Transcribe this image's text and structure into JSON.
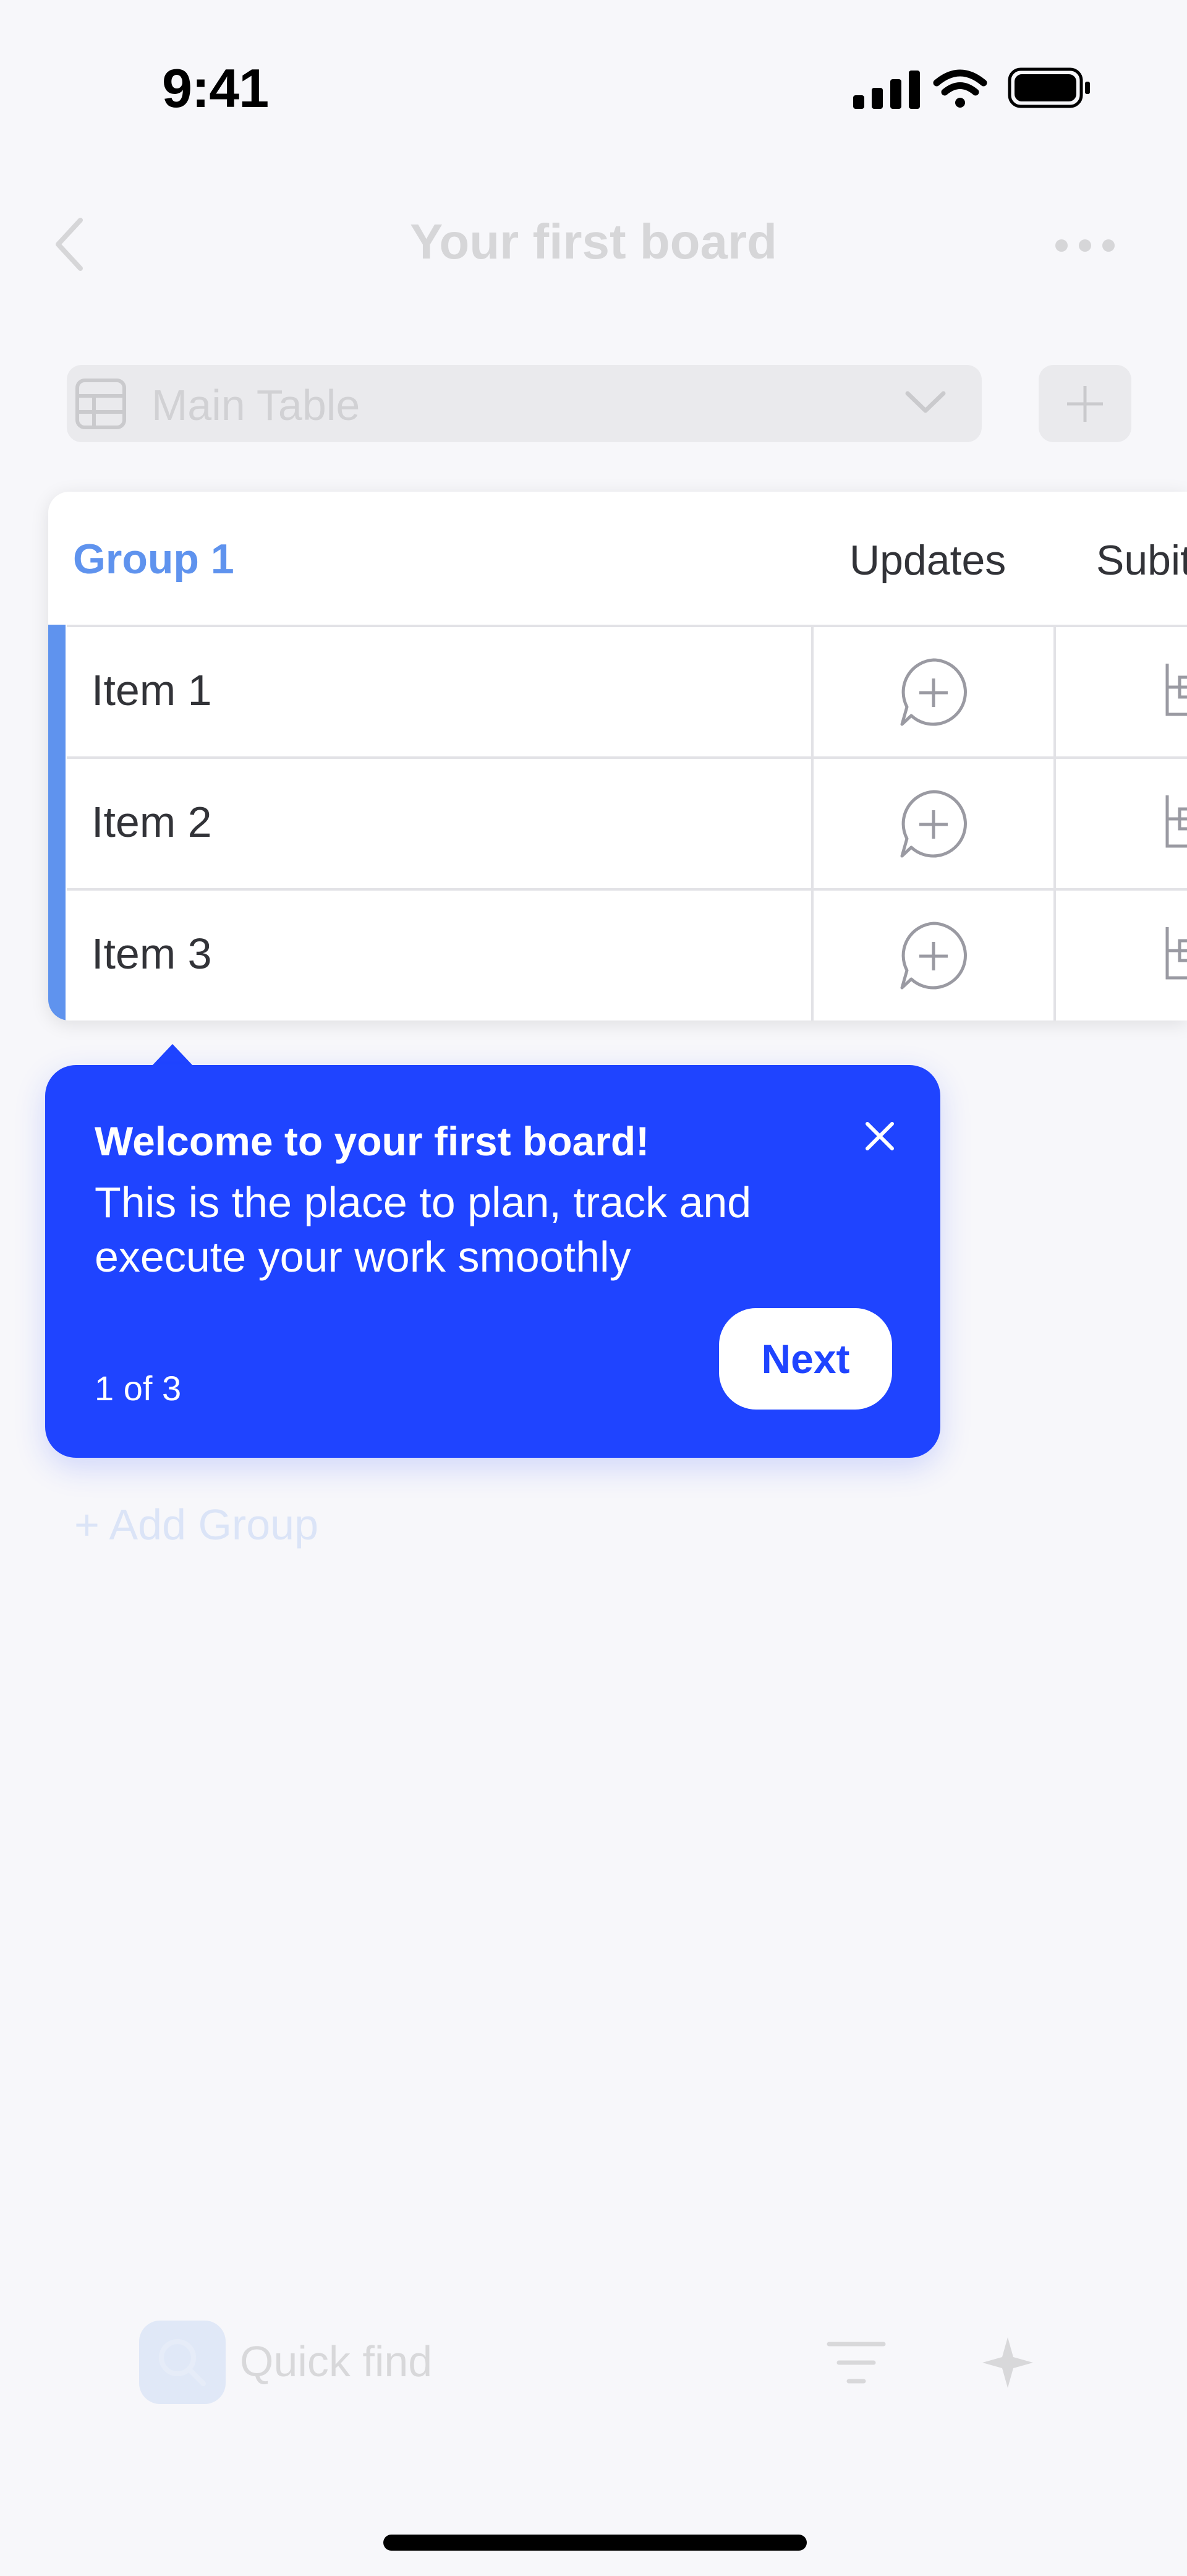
{
  "status_bar": {
    "time": "9:41",
    "icons": [
      "signal-icon",
      "wifi-icon",
      "battery-icon"
    ]
  },
  "header": {
    "title": "Your first board",
    "back_icon": "chevron-left-icon",
    "more_icon": "more-horizontal-icon"
  },
  "view_tabs": {
    "active_label": "Main Table",
    "table_icon": "table-icon",
    "dropdown_icon": "chevron-down-icon",
    "add_icon": "plus-icon"
  },
  "board": {
    "group": {
      "title": "Group 1",
      "color": "#5f93ee"
    },
    "columns": [
      "Updates",
      "Subitems"
    ],
    "items": [
      {
        "name": "Item 1"
      },
      {
        "name": "Item 2"
      },
      {
        "name": "Item 3"
      }
    ],
    "add_group_label": "+ Add Group"
  },
  "tooltip": {
    "title": "Welcome to your first board!",
    "body": "This is the place to plan, track and execute your work smoothly",
    "counter": "1 of 3",
    "next_label": "Next",
    "close_icon": "close-icon",
    "background_color": "#1f44ff"
  },
  "bottom_bar": {
    "search_placeholder": "Quick find",
    "search_icon": "search-icon",
    "filter_icon": "filter-icon",
    "sparkle_icon": "sparkle-icon"
  }
}
